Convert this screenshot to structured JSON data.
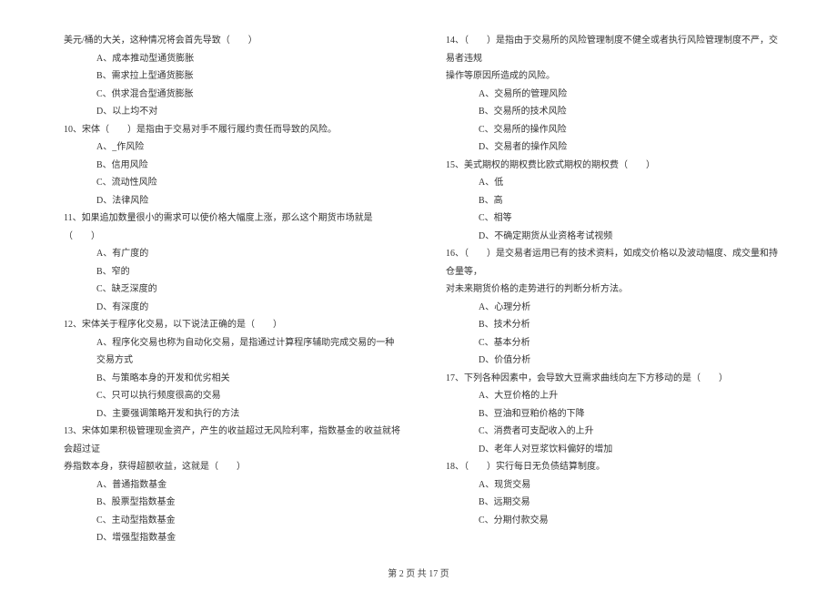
{
  "left": {
    "cont_stem": "美元/桶的大关，这种情况将会首先导致（　　）",
    "cont_opts": [
      "A、成本推动型通货膨胀",
      "B、需求拉上型通货膨胀",
      "C、供求混合型通货膨胀",
      "D、以上均不对"
    ],
    "q10": {
      "stem": "10、宋体（　　）是指由于交易对手不履行履约责任而导致的风险。",
      "opts": [
        "A、_作风险",
        "B、信用风险",
        "C、流动性风险",
        "D、法律风险"
      ]
    },
    "q11": {
      "stem": "11、如果追加数量很小的需求可以使价格大幅度上涨，那么这个期货市场就是（　　）",
      "opts": [
        "A、有广度的",
        "B、窄的",
        "C、缺乏深度的",
        "D、有深度的"
      ]
    },
    "q12": {
      "stem": "12、宋体关于程序化交易，以下说法正确的是（　　）",
      "opts": [
        "A、程序化交易也称为自动化交易，是指通过计算程序辅助完成交易的一种交易方式",
        "B、与策略本身的开发和优劣相关",
        "C、只可以执行频度很高的交易",
        "D、主要强调策略开发和执行的方法"
      ]
    },
    "q13": {
      "stem_a": "13、宋体如果积极管理现金资产，产生的收益超过无风险利率，指数基金的收益就将会超过证",
      "stem_b": "券指数本身，获得超额收益，这就是（　　）",
      "opts": [
        "A、普通指数基金",
        "B、股票型指数基金",
        "C、主动型指数基金",
        "D、增强型指数基金"
      ]
    }
  },
  "right": {
    "q14": {
      "stem_a": "14、（　　）是指由于交易所的风险管理制度不健全或者执行风险管理制度不严，交易者违规",
      "stem_b": "操作等原因所造成的风险。",
      "opts": [
        "A、交易所的管理风险",
        "B、交易所的技术风险",
        "C、交易所的操作风险",
        "D、交易者的操作风险"
      ]
    },
    "q15": {
      "stem": "15、美式期权的期权费比欧式期权的期权费（　　）",
      "opts": [
        "A、低",
        "B、高",
        "C、相等",
        "D、不确定期货从业资格考试视频"
      ]
    },
    "q16": {
      "stem_a": "16、（　　）是交易者运用已有的技术资料，如成交价格以及波动幅度、成交量和持仓量等，",
      "stem_b": "对未来期货价格的走势进行的判断分析方法。",
      "opts": [
        "A、心理分析",
        "B、技术分析",
        "C、基本分析",
        "D、价值分析"
      ]
    },
    "q17": {
      "stem": "17、下列各种因素中，会导致大豆需求曲线向左下方移动的是（　　）",
      "opts": [
        "A、大豆价格的上升",
        "B、豆油和豆粕价格的下降",
        "C、消费者可支配收入的上升",
        "D、老年人对豆浆饮料偏好的增加"
      ]
    },
    "q18": {
      "stem": "18、（　　）实行每日无负债结算制度。",
      "opts": [
        "A、现货交易",
        "B、远期交易",
        "C、分期付款交易"
      ]
    }
  },
  "footer": "第 2 页 共 17 页"
}
